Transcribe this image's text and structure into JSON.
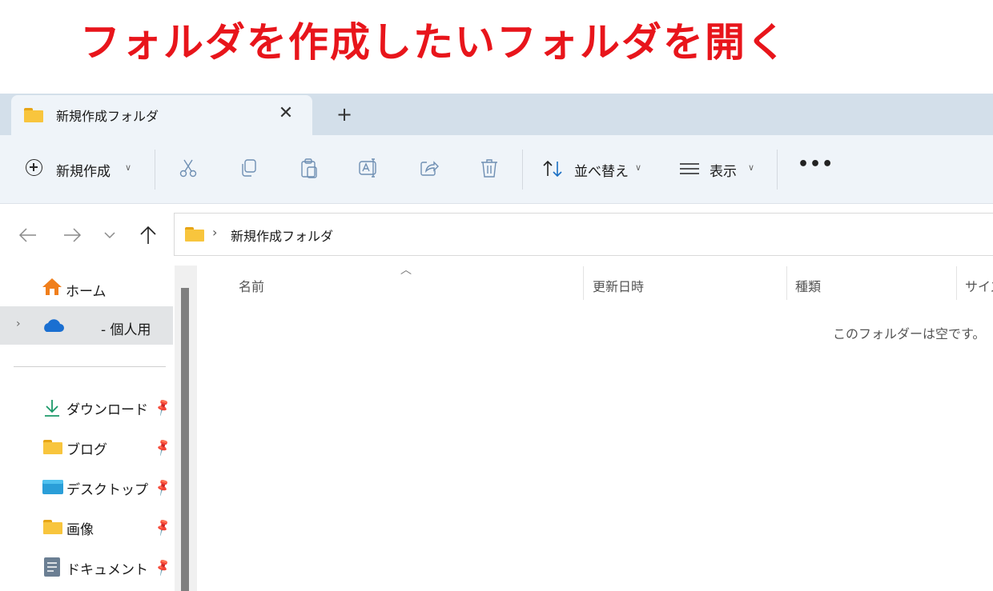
{
  "caption": "フォルダを作成したいフォルダを開く",
  "tab": {
    "title": "新規作成フォルダ",
    "close_glyph": "✕",
    "new_glyph": "+"
  },
  "toolbar": {
    "new_label": "新規作成",
    "sort_label": "並べ替え",
    "view_label": "表示",
    "more_glyph": "•••",
    "icons": [
      "cut-icon",
      "copy-icon",
      "paste-icon",
      "rename-icon",
      "share-icon",
      "delete-icon"
    ]
  },
  "address": {
    "separator": "›",
    "path": "新規作成フォルダ"
  },
  "sidebar": {
    "home": "ホーム",
    "onedrive": "- 個人用",
    "items": [
      {
        "label": "ダウンロード",
        "icon": "download-icon"
      },
      {
        "label": "ブログ",
        "icon": "folder-icon"
      },
      {
        "label": "デスクトップ",
        "icon": "desktop-icon"
      },
      {
        "label": "画像",
        "icon": "folder-icon"
      },
      {
        "label": "ドキュメント",
        "icon": "document-icon"
      }
    ]
  },
  "columns": {
    "name": "名前",
    "date": "更新日時",
    "type": "種類",
    "size": "サイズ"
  },
  "empty_message": "このフォルダーは空です。",
  "colors": {
    "caption": "#e8151b",
    "folder": "#f8c53d",
    "tabbar": "#d3dfea",
    "toolbar": "#eff4f9"
  }
}
